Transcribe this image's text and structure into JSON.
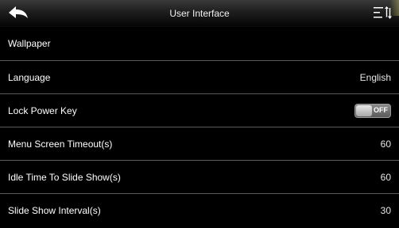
{
  "header": {
    "title": "User Interface",
    "back_icon": "back-arrow-icon",
    "sort_icon": "sort-menu-icon"
  },
  "settings": [
    {
      "label": "Wallpaper",
      "value": ""
    },
    {
      "label": "Language",
      "value": "English"
    },
    {
      "label": "Lock Power Key",
      "toggle": "OFF"
    },
    {
      "label": "Menu Screen Timeout(s)",
      "value": "60"
    },
    {
      "label": "Idle Time To Slide Show(s)",
      "value": "60"
    },
    {
      "label": "Slide Show Interval(s)",
      "value": "30"
    }
  ],
  "colors": {
    "background": "#000000",
    "separator": "#5a5a5a",
    "toggle_off": "#6a6a6a"
  }
}
